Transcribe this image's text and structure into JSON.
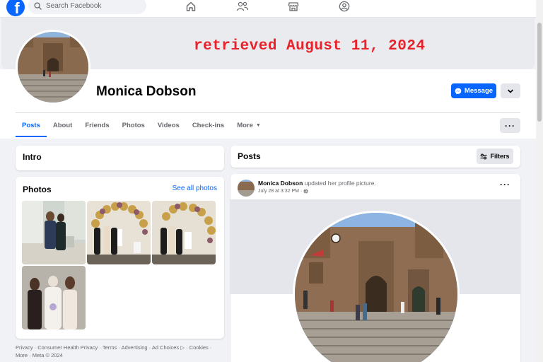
{
  "topbar": {
    "logo_letter": "f",
    "search_placeholder": "Search Facebook",
    "nav_icons": [
      "home-icon",
      "friends-icon",
      "marketplace-icon",
      "groups-icon"
    ]
  },
  "cover": {
    "overlay_text": "retrieved August 11, 2024"
  },
  "profile": {
    "name": "Monica Dobson",
    "message_label": "Message"
  },
  "tabs": {
    "items": [
      "Posts",
      "About",
      "Friends",
      "Photos",
      "Videos",
      "Check-ins",
      "More"
    ],
    "active": "Posts"
  },
  "intro": {
    "title": "Intro"
  },
  "photos": {
    "title": "Photos",
    "see_all": "See all photos"
  },
  "footer": {
    "links": "Privacy · Consumer Health Privacy · Terms · Advertising · Ad Choices ▷ · Cookies · More · Meta © 2024"
  },
  "posts": {
    "title": "Posts",
    "filters_label": "Filters",
    "post": {
      "author": "Monica Dobson",
      "action": "updated her profile picture.",
      "date": "July 28 at 3:32 PM ·"
    }
  },
  "colors": {
    "brand_blue": "#0866ff",
    "overlay_red": "#e8222a"
  }
}
